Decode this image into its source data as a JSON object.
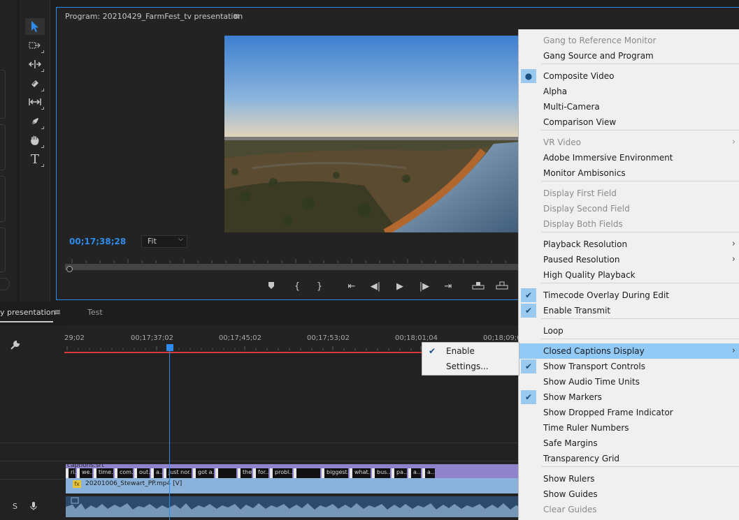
{
  "monitor": {
    "title": "Program: 20210429_FarmFest_tv presentation",
    "menu_icon": "≡",
    "timecode": "00;17;38;28",
    "zoom": "Fit"
  },
  "timeline": {
    "tab_active": "y presentation",
    "tab_menu_icon": "≡",
    "tab_other": "Test",
    "ruler_labels": [
      "29;02",
      "00;17;37;02",
      "00;17;45;02",
      "00;17;53;02",
      "00;18;01;04",
      "00;18;09;0"
    ],
    "captions_label": "captions.srt",
    "caption_chips": [
      "ri...",
      "we...",
      "time...",
      "com...",
      "out...",
      "a...",
      "just nor...",
      "got a...",
      "",
      "the...",
      "for...",
      "probl...",
      "",
      "biggest...",
      "what...",
      "bus...",
      "pa...",
      "a...",
      "a..."
    ],
    "video_clip_label": "20201006_Stewart_PP.mp4 [V]",
    "track_header_s": "S"
  },
  "menu": {
    "items": [
      {
        "label": "Gang to Reference Monitor",
        "disabled": true
      },
      {
        "label": "Gang Source and Program"
      },
      {
        "label": "Composite Video",
        "mark": "dot"
      },
      {
        "label": "Alpha"
      },
      {
        "label": "Multi-Camera"
      },
      {
        "label": "Comparison View"
      },
      {
        "label": "VR Video",
        "disabled": true,
        "submenu": true
      },
      {
        "label": "Adobe Immersive Environment"
      },
      {
        "label": "Monitor Ambisonics"
      },
      {
        "label": "Display First Field",
        "disabled": true
      },
      {
        "label": "Display Second Field",
        "disabled": true
      },
      {
        "label": "Display Both Fields",
        "disabled": true
      },
      {
        "label": "Playback Resolution",
        "submenu": true
      },
      {
        "label": "Paused Resolution",
        "submenu": true
      },
      {
        "label": "High Quality Playback"
      },
      {
        "label": "Timecode Overlay During Edit",
        "mark": "check"
      },
      {
        "label": "Enable Transmit",
        "mark": "check"
      },
      {
        "label": "Loop"
      },
      {
        "label": "Closed Captions Display",
        "submenu": true,
        "highlighted": true
      },
      {
        "label": "Show Transport Controls",
        "mark": "check"
      },
      {
        "label": "Show Audio Time Units"
      },
      {
        "label": "Show Markers",
        "mark": "check"
      },
      {
        "label": "Show Dropped Frame Indicator"
      },
      {
        "label": "Time Ruler Numbers"
      },
      {
        "label": "Safe Margins"
      },
      {
        "label": "Transparency Grid"
      },
      {
        "label": "Show Rulers"
      },
      {
        "label": "Show Guides"
      },
      {
        "label": "Clear Guides",
        "disabled": true
      }
    ]
  },
  "submenu": {
    "items": [
      {
        "label": "Enable",
        "mark": "check"
      },
      {
        "label": "Settings..."
      }
    ]
  },
  "icons": {
    "check": "✔",
    "dot": "●",
    "arrow": "›"
  },
  "colors": {
    "accent": "#2d8ceb",
    "menu_bg": "#f0f0f0",
    "menu_highlight": "#91c9f7",
    "captions_track": "#8f83cc",
    "video_track": "#8ab2da",
    "playhead_line": "#d93a3a"
  }
}
